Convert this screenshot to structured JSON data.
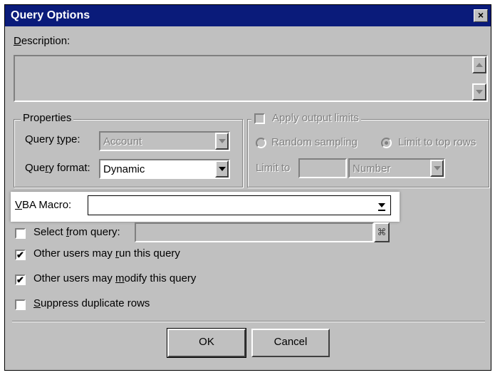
{
  "title": "Query Options",
  "close_glyph": "×",
  "description": {
    "label_u": "D",
    "label_rest": "escription:",
    "value": ""
  },
  "properties": {
    "group_label": "Properties",
    "query_type_label_a": "Query ",
    "query_type_label_u": "t",
    "query_type_label_b": "ype:",
    "query_type_value": "Account",
    "query_format_label_a": "Que",
    "query_format_label_u": "r",
    "query_format_label_b": "y format:",
    "query_format_value": "Dynamic"
  },
  "output_limits": {
    "label": "Apply output limits",
    "random_sampling": "Random sampling",
    "limit_top_rows": "Limit to top rows",
    "limit_to_label": "Limit to",
    "limit_value": "",
    "unit_value": "Number"
  },
  "vba_macro": {
    "label_u": "V",
    "label_rest": "BA Macro:",
    "value": ""
  },
  "select_from_query": {
    "label_a": "Select ",
    "label_u": "f",
    "label_b": "rom query:",
    "value": "",
    "checked": false
  },
  "run_query": {
    "label_a": "Other users may ",
    "label_u": "r",
    "label_b": "un this query",
    "checked": true
  },
  "modify_query": {
    "label_a": "Other users may ",
    "label_u": "m",
    "label_b": "odify this query",
    "checked": true
  },
  "suppress_dupes": {
    "label_u": "S",
    "label_b": "uppress duplicate rows",
    "checked": false
  },
  "check_glyph": "✔",
  "binoculars_glyph": "⌘",
  "ok_label": "OK",
  "cancel_label": "Cancel",
  "colors": {
    "title_bar": "#0a1b7a",
    "face": "#c0c0c0"
  }
}
